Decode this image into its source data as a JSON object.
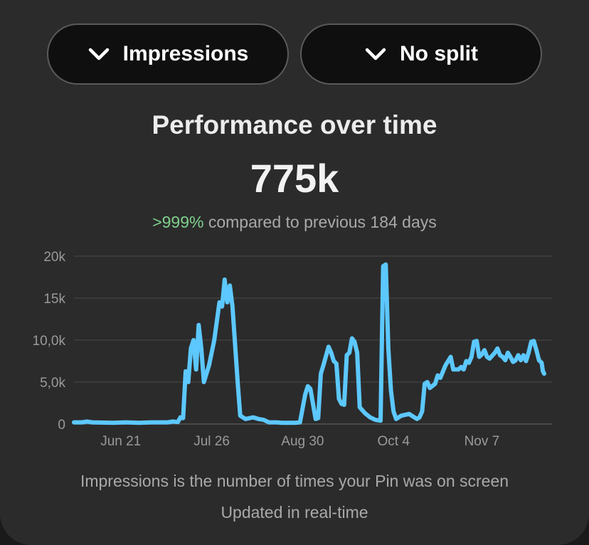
{
  "controls": {
    "metric_label": "Impressions",
    "split_label": "No split",
    "chevron_icon": "chevron-down-icon"
  },
  "summary": {
    "title": "Performance over time",
    "total": "775k",
    "change_pct": ">999%",
    "change_text": " compared to previous 184 days"
  },
  "colors": {
    "line": "#5cc8ff",
    "positive": "#7fd18c",
    "grid": "#4a4a4a"
  },
  "chart_data": {
    "type": "line",
    "title": "",
    "xlabel": "",
    "ylabel": "",
    "ylim": [
      0,
      20000
    ],
    "yticks": [
      {
        "value": 0,
        "label": "0"
      },
      {
        "value": 5000,
        "label": "5,0k"
      },
      {
        "value": 10000,
        "label": "10,0k"
      },
      {
        "value": 15000,
        "label": "15k"
      },
      {
        "value": 20000,
        "label": "20k"
      }
    ],
    "xticks": [
      {
        "value": 18,
        "label": "Jun 21"
      },
      {
        "value": 53,
        "label": "Jul 26"
      },
      {
        "value": 88,
        "label": "Aug 30"
      },
      {
        "value": 123,
        "label": "Oct 4"
      },
      {
        "value": 157,
        "label": "Nov 7"
      }
    ],
    "xlim": [
      0,
      184
    ],
    "grid": true,
    "series": [
      {
        "values": [
          [
            0,
            200
          ],
          [
            3,
            200
          ],
          [
            5,
            300
          ],
          [
            7,
            200
          ],
          [
            15,
            150
          ],
          [
            20,
            200
          ],
          [
            25,
            150
          ],
          [
            30,
            200
          ],
          [
            36,
            200
          ],
          [
            38,
            300
          ],
          [
            40,
            250
          ],
          [
            41,
            800
          ],
          [
            42,
            700
          ],
          [
            43,
            6300
          ],
          [
            44,
            5000
          ],
          [
            45,
            9000
          ],
          [
            46,
            10000
          ],
          [
            47,
            6500
          ],
          [
            48,
            11800
          ],
          [
            49,
            9000
          ],
          [
            50,
            5000
          ],
          [
            52,
            7000
          ],
          [
            54,
            10000
          ],
          [
            56,
            14500
          ],
          [
            57,
            14000
          ],
          [
            58,
            17200
          ],
          [
            59,
            14500
          ],
          [
            60,
            16500
          ],
          [
            61,
            14000
          ],
          [
            63,
            5000
          ],
          [
            64,
            1000
          ],
          [
            66,
            600
          ],
          [
            69,
            800
          ],
          [
            71,
            600
          ],
          [
            73,
            500
          ],
          [
            75,
            200
          ],
          [
            78,
            200
          ],
          [
            80,
            150
          ],
          [
            85,
            150
          ],
          [
            87,
            200
          ],
          [
            89,
            3500
          ],
          [
            90,
            4500
          ],
          [
            91,
            4200
          ],
          [
            93,
            600
          ],
          [
            94,
            700
          ],
          [
            95,
            6000
          ],
          [
            96,
            7000
          ],
          [
            98,
            9200
          ],
          [
            99,
            8500
          ],
          [
            100,
            7500
          ],
          [
            101,
            7200
          ],
          [
            102,
            3000
          ],
          [
            103,
            2400
          ],
          [
            104,
            2300
          ],
          [
            105,
            8200
          ],
          [
            106,
            8500
          ],
          [
            107,
            10200
          ],
          [
            108,
            9800
          ],
          [
            109,
            8500
          ],
          [
            110,
            2000
          ],
          [
            112,
            1300
          ],
          [
            114,
            800
          ],
          [
            116,
            500
          ],
          [
            118,
            400
          ],
          [
            119,
            18800
          ],
          [
            120,
            19000
          ],
          [
            121,
            9000
          ],
          [
            122,
            4000
          ],
          [
            123,
            1500
          ],
          [
            124,
            600
          ],
          [
            126,
            1000
          ],
          [
            129,
            1200
          ],
          [
            130,
            1000
          ],
          [
            132,
            600
          ],
          [
            133,
            800
          ],
          [
            134,
            1500
          ],
          [
            135,
            4800
          ],
          [
            136,
            5000
          ],
          [
            137,
            4300
          ],
          [
            139,
            4800
          ],
          [
            140,
            5800
          ],
          [
            141,
            5500
          ],
          [
            143,
            7000
          ],
          [
            145,
            8000
          ],
          [
            146,
            6500
          ],
          [
            148,
            6500
          ],
          [
            149,
            6800
          ],
          [
            150,
            6500
          ],
          [
            151,
            7500
          ],
          [
            152,
            7300
          ],
          [
            153,
            8000
          ],
          [
            154,
            9800
          ],
          [
            155,
            9900
          ],
          [
            156,
            8000
          ],
          [
            157,
            8300
          ],
          [
            158,
            8800
          ],
          [
            159,
            8000
          ],
          [
            160,
            7800
          ],
          [
            162,
            8500
          ],
          [
            163,
            9000
          ],
          [
            164,
            8200
          ],
          [
            165,
            8000
          ],
          [
            166,
            7600
          ],
          [
            167,
            8500
          ],
          [
            168,
            8000
          ],
          [
            169,
            7400
          ],
          [
            170,
            7600
          ],
          [
            171,
            8200
          ],
          [
            172,
            7600
          ],
          [
            173,
            8200
          ],
          [
            174,
            7500
          ],
          [
            175,
            8500
          ],
          [
            176,
            9800
          ],
          [
            177,
            9900
          ],
          [
            178,
            8800
          ],
          [
            179,
            7600
          ],
          [
            180,
            7300
          ],
          [
            180.5,
            6300
          ],
          [
            181,
            6000
          ]
        ]
      }
    ]
  },
  "footer": {
    "definition": "Impressions is the number of times your Pin was on screen",
    "updated": "Updated in real-time"
  }
}
